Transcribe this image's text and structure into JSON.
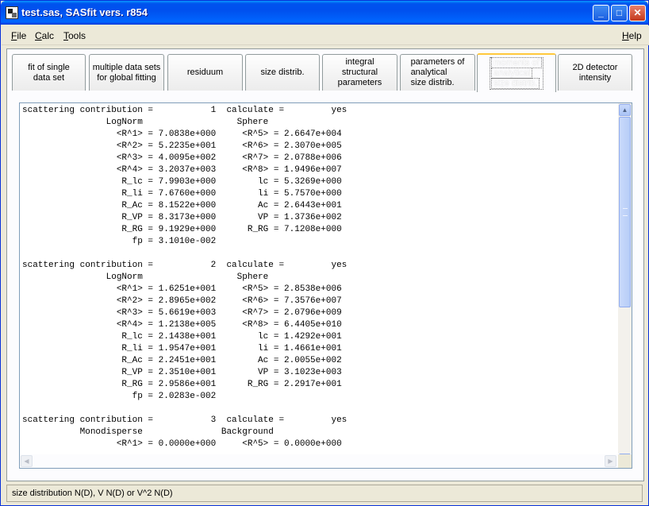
{
  "window": {
    "title": "test.sas, SASfit vers. r854",
    "controls": {
      "minimize": "_",
      "maximize": "□",
      "close": "✕"
    }
  },
  "menubar": {
    "file": {
      "mnemonic": "F",
      "rest": "ile"
    },
    "calc": {
      "mnemonic": "C",
      "rest": "alc"
    },
    "tools": {
      "mnemonic": "T",
      "rest": "ools"
    },
    "help": {
      "mnemonic": "H",
      "rest": "elp"
    }
  },
  "tabs": [
    {
      "line1": "fit of single",
      "line2": "data set",
      "line3": ""
    },
    {
      "line1": "multiple data sets",
      "line2": "for global fitting",
      "line3": ""
    },
    {
      "line1": "residuum",
      "line2": "",
      "line3": ""
    },
    {
      "line1": "size distrib.",
      "line2": "",
      "line3": ""
    },
    {
      "line1": "integral",
      "line2": "structural",
      "line3": "parameters"
    },
    {
      "line1": "parameters of",
      "line2": "analytical",
      "line3": "size distrib."
    },
    {
      "line1": "moments of",
      "line2": "analytical",
      "line3": "size distrib."
    },
    {
      "line1": "2D detector",
      "line2": "intensity",
      "line3": ""
    }
  ],
  "active_tab_index": 6,
  "output_text": "scattering contribution =           1  calculate =         yes\n                LogNorm                  Sphere\n                  <R^1> = 7.0838e+000     <R^5> = 2.6647e+004\n                  <R^2> = 5.2235e+001     <R^6> = 2.3070e+005\n                  <R^3> = 4.0095e+002     <R^7> = 2.0788e+006\n                  <R^4> = 3.2037e+003     <R^8> = 1.9496e+007\n                   R_lc = 7.9903e+000        lc = 5.3269e+000\n                   R_li = 7.6760e+000        li = 5.7570e+000\n                   R_Ac = 8.1522e+000        Ac = 2.6443e+001\n                   R_VP = 8.3173e+000        VP = 1.3736e+002\n                   R_RG = 9.1929e+000      R_RG = 7.1208e+000\n                     fp = 3.1010e-002\n\nscattering contribution =           2  calculate =         yes\n                LogNorm                  Sphere\n                  <R^1> = 1.6251e+001     <R^5> = 2.8538e+006\n                  <R^2> = 2.8965e+002     <R^6> = 7.3576e+007\n                  <R^3> = 5.6619e+003     <R^7> = 2.0796e+009\n                  <R^4> = 1.2138e+005     <R^8> = 6.4405e+010\n                   R_lc = 2.1438e+001        lc = 1.4292e+001\n                   R_li = 1.9547e+001        li = 1.4661e+001\n                   R_Ac = 2.2451e+001        Ac = 2.0055e+002\n                   R_VP = 2.3510e+001        VP = 3.1023e+003\n                   R_RG = 2.9586e+001      R_RG = 2.2917e+001\n                     fp = 2.0283e-002\n\nscattering contribution =           3  calculate =         yes\n           Monodisperse               Background\n                  <R^1> = 0.0000e+000     <R^5> = 0.0000e+000",
  "scroll": {
    "up_arrow": "▲",
    "down_arrow": "▼",
    "left_arrow": "◀",
    "right_arrow": "▶"
  },
  "statusbar": {
    "text": "size distribution N(D), V N(D) or V^2 N(D)"
  },
  "colors": {
    "titlebar": "#0053ee",
    "face": "#ece9d8",
    "active_tab_accent": "#ffc83c"
  }
}
